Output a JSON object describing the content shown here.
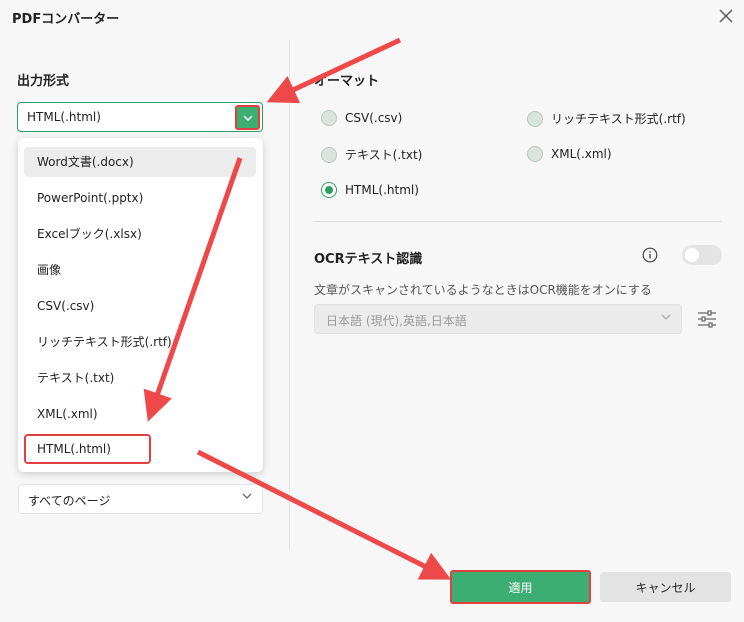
{
  "window": {
    "title": "PDFコンバーター"
  },
  "left": {
    "output_format_label": "出力形式",
    "output_format_value": "HTML(.html)",
    "dropdown_items": [
      {
        "label": "Word文書(.docx)",
        "state": "hover"
      },
      {
        "label": "PowerPoint(.pptx)",
        "state": ""
      },
      {
        "label": "Excelブック(.xlsx)",
        "state": ""
      },
      {
        "label": "画像",
        "state": ""
      },
      {
        "label": "CSV(.csv)",
        "state": ""
      },
      {
        "label": "リッチテキスト形式(.rtf)",
        "state": ""
      },
      {
        "label": "テキスト(.txt)",
        "state": ""
      },
      {
        "label": "XML(.xml)",
        "state": ""
      },
      {
        "label": "HTML(.html)",
        "state": "selected"
      }
    ],
    "page_range_value": "すべてのページ"
  },
  "right": {
    "format_heading": "オーマット",
    "radio_options": [
      {
        "label": "CSV(.csv)",
        "checked": false
      },
      {
        "label": "リッチテキスト形式(.rtf)",
        "checked": false
      },
      {
        "label": "テキスト(.txt)",
        "checked": false
      },
      {
        "label": "XML(.xml)",
        "checked": false
      },
      {
        "label": "HTML(.html)",
        "checked": true
      }
    ],
    "ocr_heading": "OCRテキスト認識",
    "ocr_enabled": false,
    "ocr_description": "文章がスキャンされているようなときはOCR機能をオンにする",
    "ocr_language_value": "日本語 (現代),英語,日本語"
  },
  "buttons": {
    "apply": "適用",
    "cancel": "キャンセル"
  },
  "colors": {
    "accent": "#3cae72",
    "highlight": "#e0403f",
    "annotation_arrow": "#ee4848"
  }
}
